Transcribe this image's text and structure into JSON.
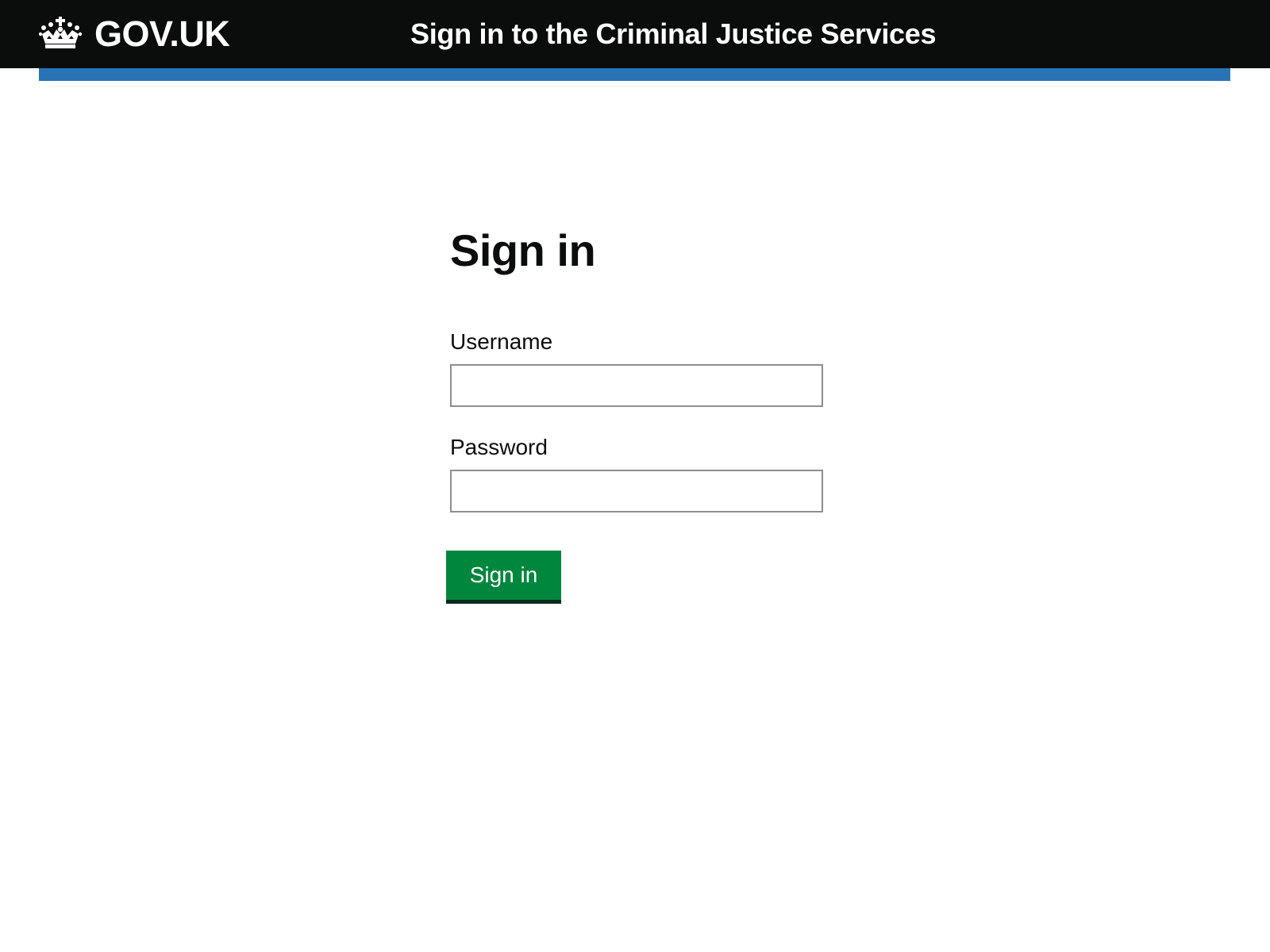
{
  "header": {
    "logo_text": "GOV.UK",
    "service_name": "Sign in to the Criminal Justice Services",
    "logo_icon": "crown-icon",
    "background_color": "#0b0c0c",
    "underline_color": "#2a74b5"
  },
  "main": {
    "title": "Sign in",
    "username": {
      "label": "Username",
      "value": "",
      "placeholder": ""
    },
    "password": {
      "label": "Password",
      "value": "",
      "placeholder": ""
    },
    "submit_label": "Sign in",
    "submit_color": "#00873d"
  }
}
